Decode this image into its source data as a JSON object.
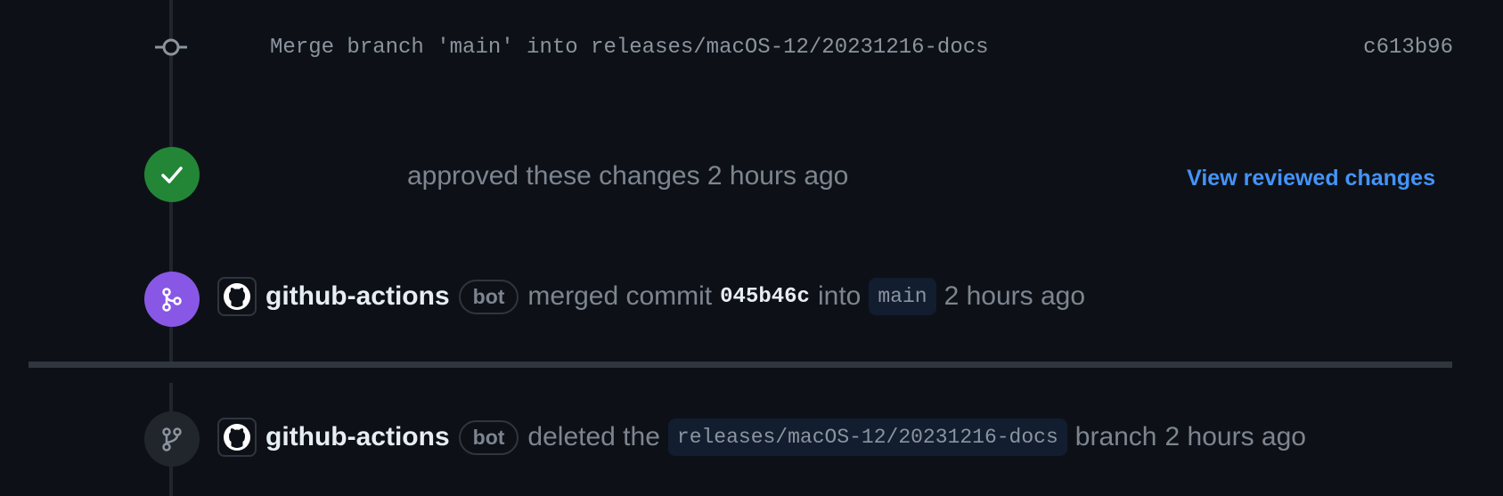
{
  "timeline": {
    "commit": {
      "message": "Merge branch 'main' into releases/macOS-12/20231216-docs",
      "sha": "c613b96"
    },
    "review": {
      "text": "approved these changes 2 hours ago",
      "link_label": "View reviewed changes"
    },
    "merge_event": {
      "actor": "github-actions",
      "actor_tag": "bot",
      "action": "merged commit",
      "commit_sha": "045b46c",
      "preposition": "into",
      "branch": "main",
      "time": "2 hours ago"
    },
    "delete_event": {
      "actor": "github-actions",
      "actor_tag": "bot",
      "action": "deleted the",
      "branch": "releases/macOS-12/20231216-docs",
      "suffix": "branch",
      "time": "2 hours ago"
    }
  },
  "colors": {
    "background": "#0d1117",
    "approved": "#238636",
    "merged": "#8957e5",
    "link": "#4493f8"
  },
  "icons": [
    "git-commit-icon",
    "check-icon",
    "git-merge-icon",
    "github-avatar-icon",
    "git-branch-icon"
  ]
}
